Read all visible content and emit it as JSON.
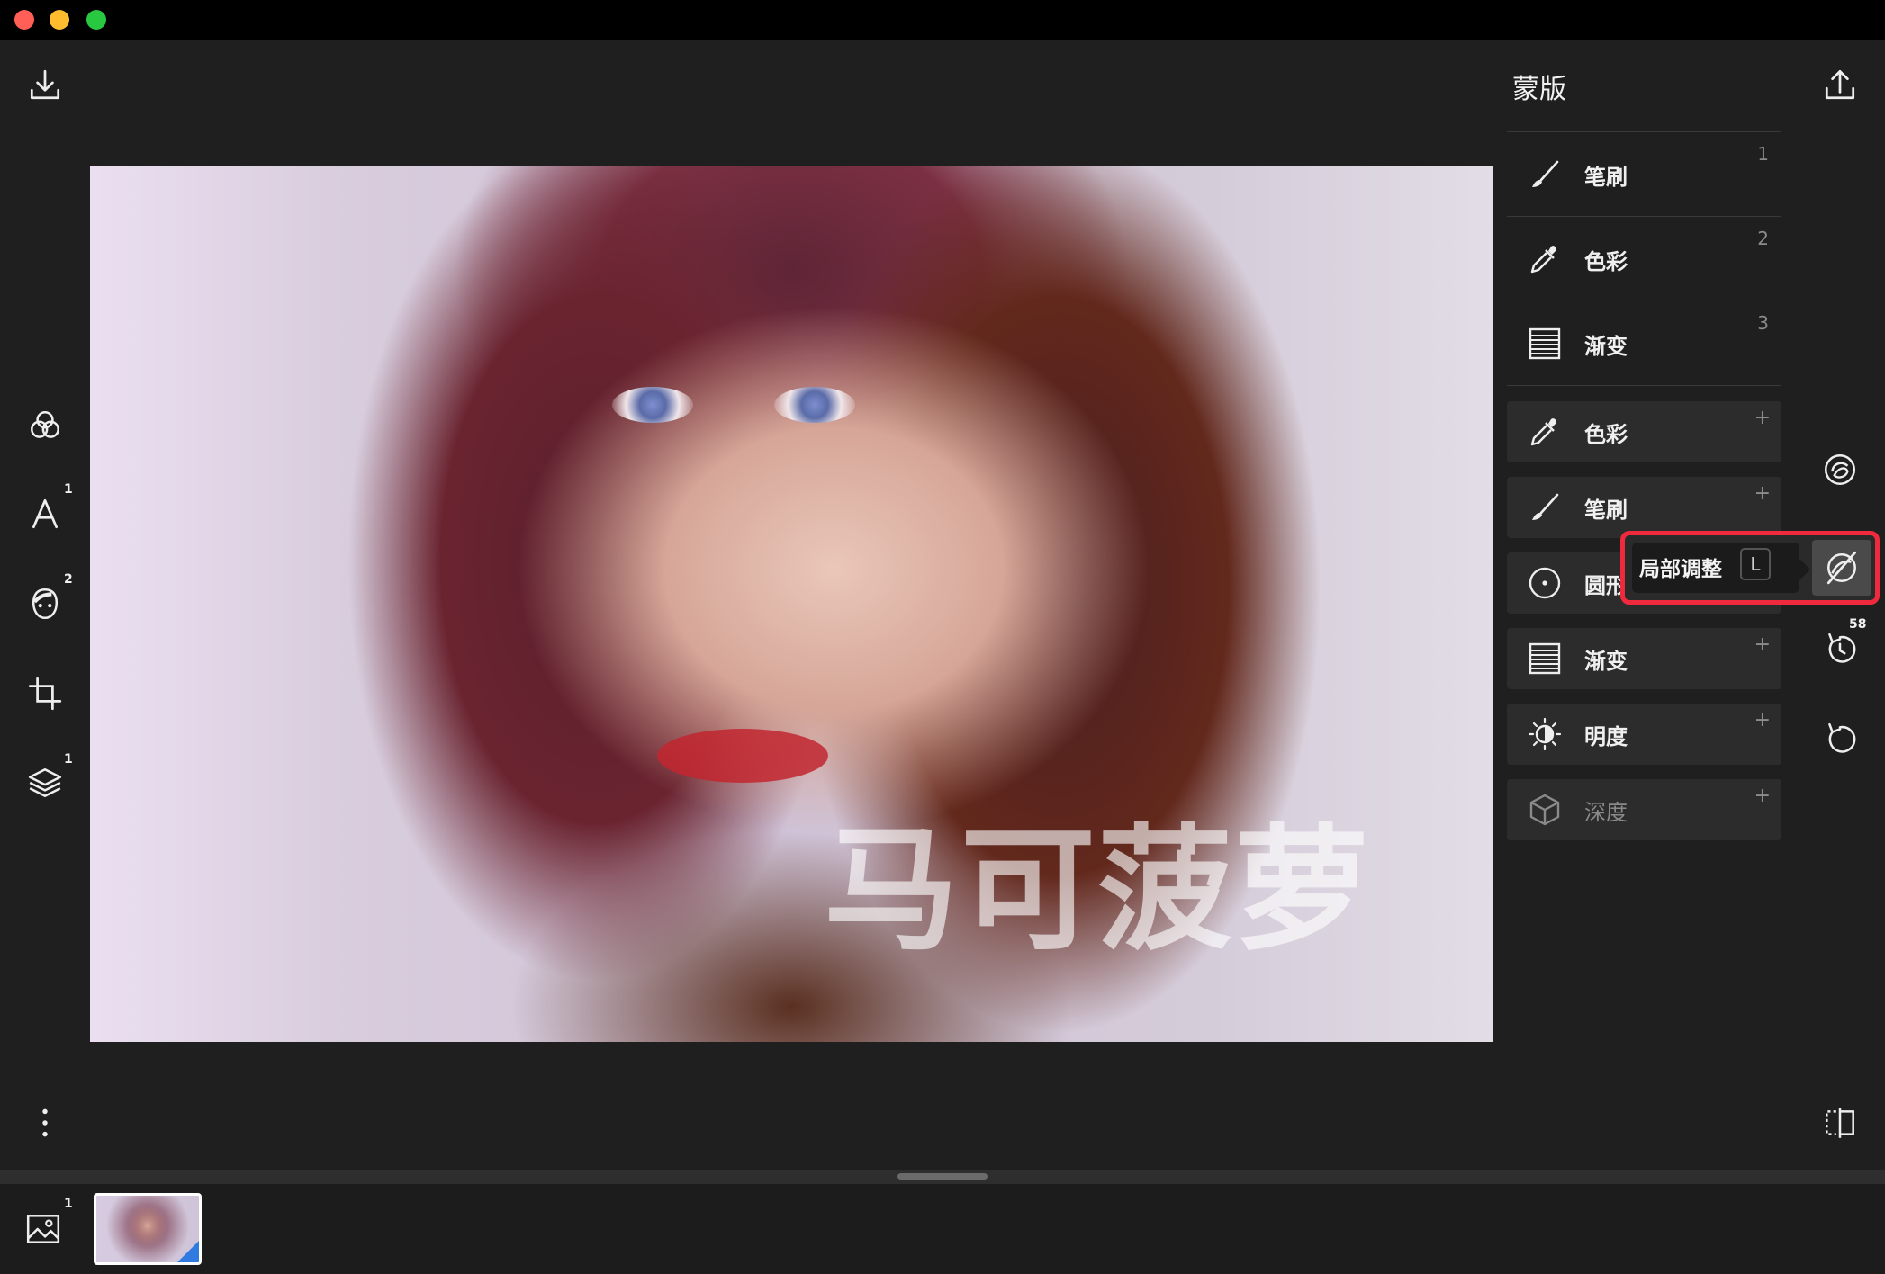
{
  "window": {
    "traffic_lights": {
      "close": "#ff5f57",
      "minimize": "#febc2e",
      "zoom": "#28c840"
    }
  },
  "left_toolbar": [
    {
      "name": "import-icon",
      "badge": ""
    },
    {
      "name": "filters-icon",
      "badge": ""
    },
    {
      "name": "text-icon",
      "badge": "1"
    },
    {
      "name": "face-icon",
      "badge": "2"
    },
    {
      "name": "crop-icon",
      "badge": ""
    },
    {
      "name": "layers-icon",
      "badge": "1"
    },
    {
      "name": "more-icon",
      "badge": ""
    }
  ],
  "canvas": {
    "watermark": "马可菠萝"
  },
  "panel": {
    "title": "蒙版",
    "tools": [
      {
        "label": "笔刷",
        "key": "1",
        "icon": "brush-icon"
      },
      {
        "label": "色彩",
        "key": "2",
        "icon": "eyedropper-icon"
      },
      {
        "label": "渐变",
        "key": "3",
        "icon": "gradient-icon"
      }
    ],
    "masks": [
      {
        "label": "色彩",
        "icon": "eyedropper-icon",
        "add": "+"
      },
      {
        "label": "笔刷",
        "icon": "brush-icon",
        "add": "+"
      },
      {
        "label": "圆形",
        "icon": "circle-icon",
        "add": "+"
      },
      {
        "label": "渐变",
        "icon": "gradient-icon",
        "add": "+"
      },
      {
        "label": "明度",
        "icon": "luminance-icon",
        "add": "+"
      },
      {
        "label": "深度",
        "icon": "depth-icon",
        "add": "+"
      }
    ]
  },
  "right_toolbar": {
    "history_badge": "58"
  },
  "tooltip": {
    "label": "局部调整",
    "shortcut": "L"
  },
  "filmstrip": {
    "images_badge": "1"
  },
  "colors": {
    "highlight": "#ef2a3c",
    "accent": "#2f7be0",
    "background": "#1f1f1f"
  }
}
